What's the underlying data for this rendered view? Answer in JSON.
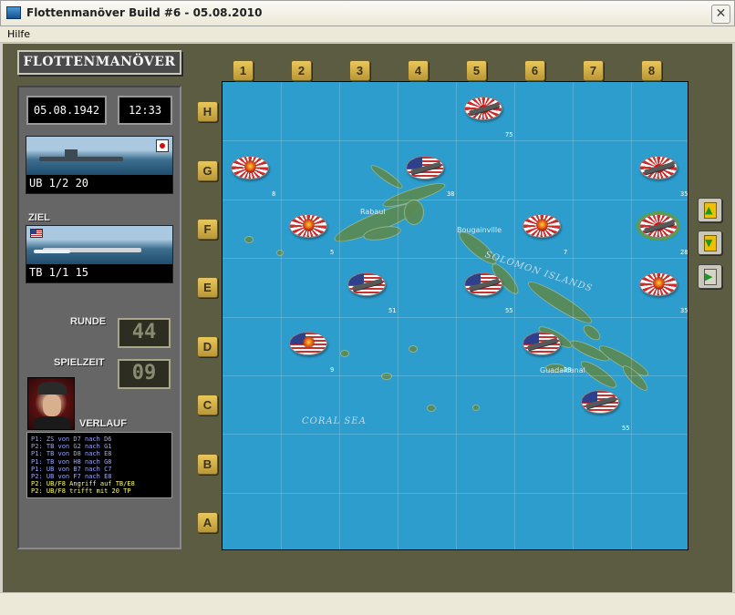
{
  "window": {
    "title": "Flottenmanöver Build #6 - 05.08.2010",
    "close_label": "✕"
  },
  "menu": {
    "help": "Hilfe"
  },
  "logo": "FLOTTENMANÖVER",
  "status": {
    "date": "05.08.1942",
    "time": "12:33"
  },
  "own_unit": {
    "label": "UB 1/2 20",
    "flag": "japan"
  },
  "target": {
    "heading": "ZIEL",
    "label": "TB 1/1 15",
    "flag": "usa"
  },
  "round": {
    "label": "RUNDE",
    "value": "44"
  },
  "playtime": {
    "label": "SPIELZEIT",
    "value": "09"
  },
  "log": {
    "label": "VERLAUF",
    "lines": [
      {
        "text": "P1: ZS von D7 nach D6",
        "color": "#9aa6ff"
      },
      {
        "text": "P2: TB von G2 nach G1",
        "color": "#9aa6ff"
      },
      {
        "text": "P1: TB von D8 nach E8",
        "color": "#9aa6ff"
      },
      {
        "text": "P1: TB von H8 nach G8",
        "color": "#9aa6ff"
      },
      {
        "text": "P1: UB von B7 nach C7",
        "color": "#9aa6ff"
      },
      {
        "text": "P2: UB von F7 nach E8",
        "color": "#9aa6ff"
      },
      {
        "text": "P2: UB/F8 Angriff auf TB/E8",
        "color": "#ffff66"
      },
      {
        "text": "P2: UB/F8 trifft mit 20 TP",
        "color": "#ffff66"
      }
    ]
  },
  "board": {
    "columns": [
      "1",
      "2",
      "3",
      "4",
      "5",
      "6",
      "7",
      "8"
    ],
    "rows": [
      "H",
      "G",
      "F",
      "E",
      "D",
      "C",
      "B",
      "A"
    ],
    "labels": {
      "rabaul": "Rabaul",
      "bougainville": "Bougainville",
      "solomon": "SOLOMON ISLANDS",
      "coral": "CORAL SEA",
      "guadalcanal": "Guadalcanal"
    },
    "units": [
      {
        "cell": "H5",
        "side": "japan",
        "kind": "ship",
        "value": "75"
      },
      {
        "cell": "G1",
        "side": "japan",
        "kind": "fire",
        "value": "8"
      },
      {
        "cell": "G4",
        "side": "usa",
        "kind": "ship",
        "value": "38"
      },
      {
        "cell": "G8",
        "side": "japan",
        "kind": "ship",
        "value": "35"
      },
      {
        "cell": "F2",
        "side": "japan",
        "kind": "fire",
        "value": "5"
      },
      {
        "cell": "F6",
        "side": "japan",
        "kind": "fire",
        "value": "7"
      },
      {
        "cell": "F8",
        "side": "japan",
        "kind": "ship",
        "value": "28",
        "selected": true
      },
      {
        "cell": "E3",
        "side": "usa",
        "kind": "ship",
        "value": "51"
      },
      {
        "cell": "E5",
        "side": "usa",
        "kind": "ship",
        "value": "55"
      },
      {
        "cell": "E8",
        "side": "japan",
        "kind": "fire",
        "value": "35"
      },
      {
        "cell": "D2",
        "side": "usa",
        "kind": "fire",
        "value": "9"
      },
      {
        "cell": "D6",
        "side": "usa",
        "kind": "ship",
        "value": "28"
      },
      {
        "cell": "C7",
        "side": "usa",
        "kind": "ship",
        "value": "55"
      }
    ]
  },
  "side_buttons": [
    {
      "name": "upload-button",
      "icon": "disk-up-icon"
    },
    {
      "name": "download-button",
      "icon": "disk-down-icon"
    },
    {
      "name": "exit-button",
      "icon": "exit-door-icon"
    }
  ]
}
